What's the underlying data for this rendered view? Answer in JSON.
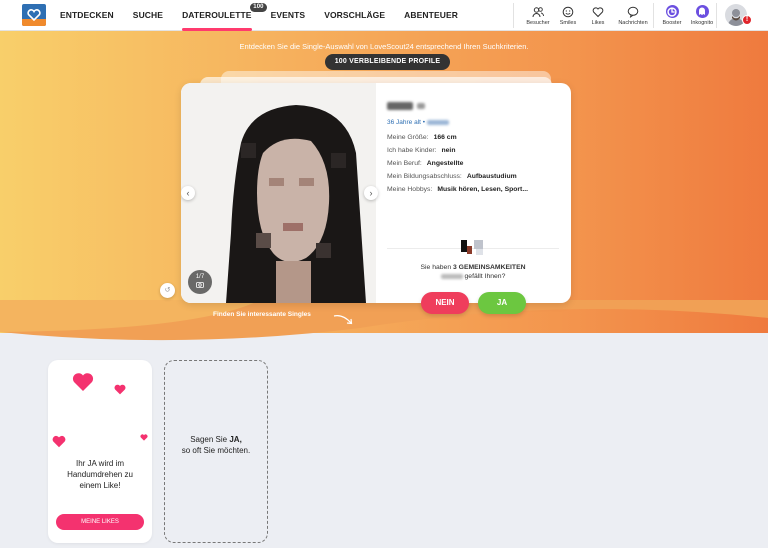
{
  "header": {
    "nav": [
      {
        "label": "ENTDECKEN",
        "active": false
      },
      {
        "label": "SUCHE",
        "active": false
      },
      {
        "label": "DATEROULETTE",
        "active": true,
        "badge": "100"
      },
      {
        "label": "EVENTS",
        "active": false
      },
      {
        "label": "VORSCHLÄGE",
        "active": false
      },
      {
        "label": "ABENTEUER",
        "active": false
      }
    ],
    "icons": [
      {
        "label": "Besucher",
        "icon": "visitors-icon"
      },
      {
        "label": "Smiles",
        "icon": "smile-icon"
      },
      {
        "label": "Likes",
        "icon": "heart-icon"
      },
      {
        "label": "Nachrichten",
        "icon": "chat-icon"
      }
    ],
    "premium": [
      {
        "label": "Booster",
        "icon": "booster-icon"
      },
      {
        "label": "Inkognito",
        "icon": "incognito-icon"
      }
    ],
    "alert_badge": "!"
  },
  "hero": {
    "intro": "Entdecken Sie die Single-Auswahl von LoveScout24 entsprechend Ihren Suchkriterien.",
    "remaining": "100 VERBLEIBENDE PROFILE",
    "photo_counter": "1/7",
    "age": "36 Jahre alt •",
    "details": [
      {
        "label": "Meine Größe:",
        "value": "166 cm"
      },
      {
        "label": "Ich habe Kinder:",
        "value": "nein"
      },
      {
        "label": "Mein Beruf:",
        "value": "Angestellte"
      },
      {
        "label": "Mein Bildungsabschluss:",
        "value": "Aufbaustudium"
      },
      {
        "label": "Meine Hobbys:",
        "value": "Musik hören, Lesen, Sport..."
      }
    ],
    "common_prefix": "Sie haben",
    "common_strong": "3 GEMEINSAMKEITEN",
    "common_suffix": "gefällt Ihnen?",
    "no_label": "NEIN",
    "yes_label": "JA",
    "hint": "Finden Sie interessante Singles"
  },
  "tiles": {
    "likes_text": "Ihr JA wird im Handumdrehen zu einem Like!",
    "likes_button": "MEINE LIKES",
    "yes_prefix": "Sagen Sie",
    "yes_strong": "JA,",
    "yes_rest": "so oft Sie möchten."
  },
  "colors": {
    "accent_pink": "#f4326f",
    "no_red": "#ef3d5c",
    "yes_green": "#6cc740",
    "brand_blue": "#2e6fb3",
    "hero_start": "#f8cf6a",
    "hero_end": "#ef7a3e"
  }
}
